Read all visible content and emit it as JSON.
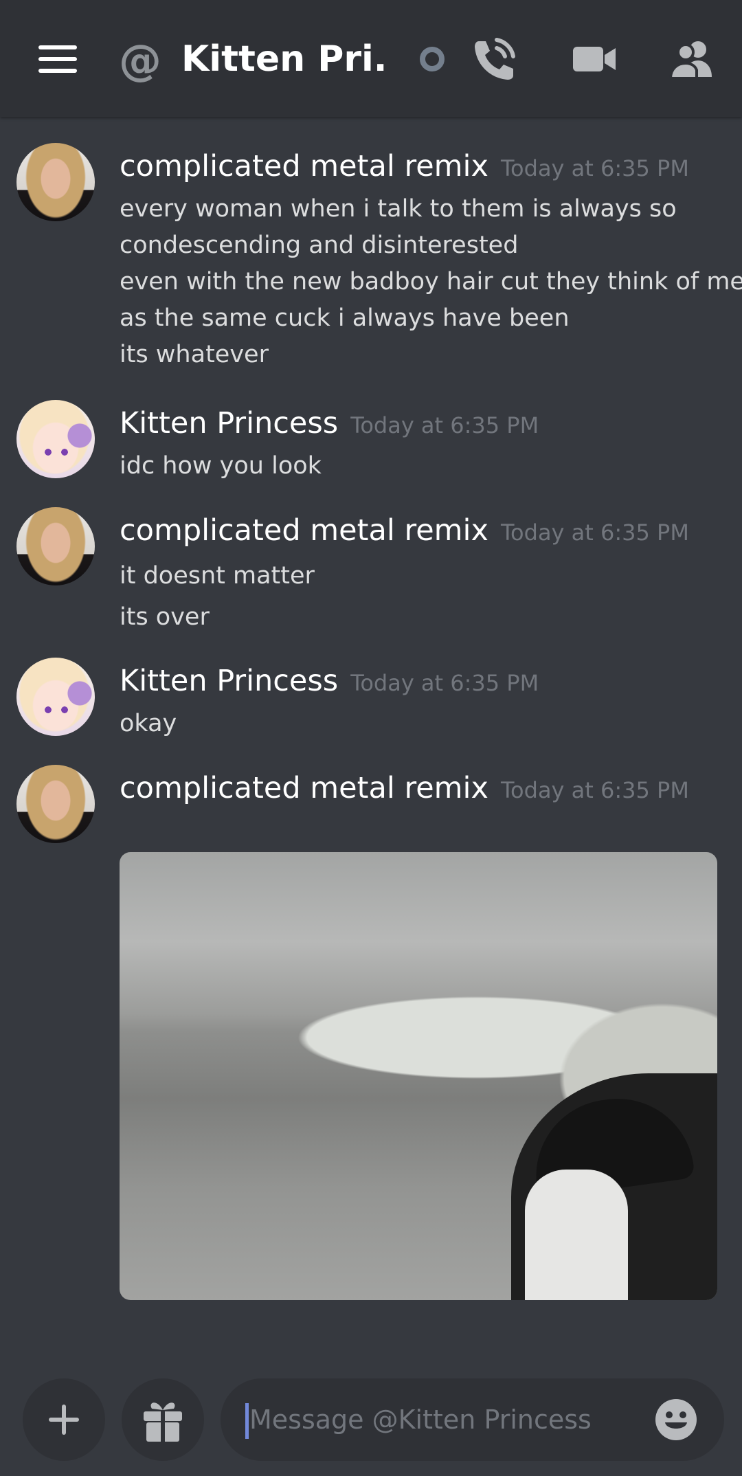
{
  "header": {
    "title": "Kitten Pri...",
    "at_symbol": "@"
  },
  "messages": [
    {
      "author": "complicated metal remix",
      "timestamp": "Today at 6:35 PM",
      "lines": [
        "every woman when i talk to them is always so",
        "condescending and disinterested",
        "even with the new badboy hair cut they think of me",
        "as the same cuck i always have been",
        "its whatever"
      ]
    },
    {
      "author": "Kitten Princess",
      "timestamp": "Today at 6:35 PM",
      "lines": [
        "idc how you look"
      ]
    },
    {
      "author": "complicated metal remix",
      "timestamp": "Today at 6:35 PM",
      "lines": [
        "it doesnt matter",
        "its over"
      ]
    },
    {
      "author": "Kitten Princess",
      "timestamp": "Today at 6:35 PM",
      "lines": [
        "okay"
      ]
    },
    {
      "author": "complicated metal remix",
      "timestamp": "Today at 6:35 PM",
      "lines": []
    }
  ],
  "composer": {
    "placeholder": "Message @Kitten Princess"
  },
  "icons": {
    "menu": "hamburger-menu-icon",
    "at": "at-sign-icon",
    "status": "status-offline-icon",
    "call": "phone-call-icon",
    "video": "video-camera-icon",
    "members": "members-icon",
    "add": "plus-icon",
    "gift": "gift-icon",
    "emoji": "emoji-smile-icon"
  },
  "colors": {
    "background": "#36393f",
    "header": "#2f3136",
    "text": "#dcddde",
    "muted": "#72767d",
    "accent": "#7289da"
  }
}
